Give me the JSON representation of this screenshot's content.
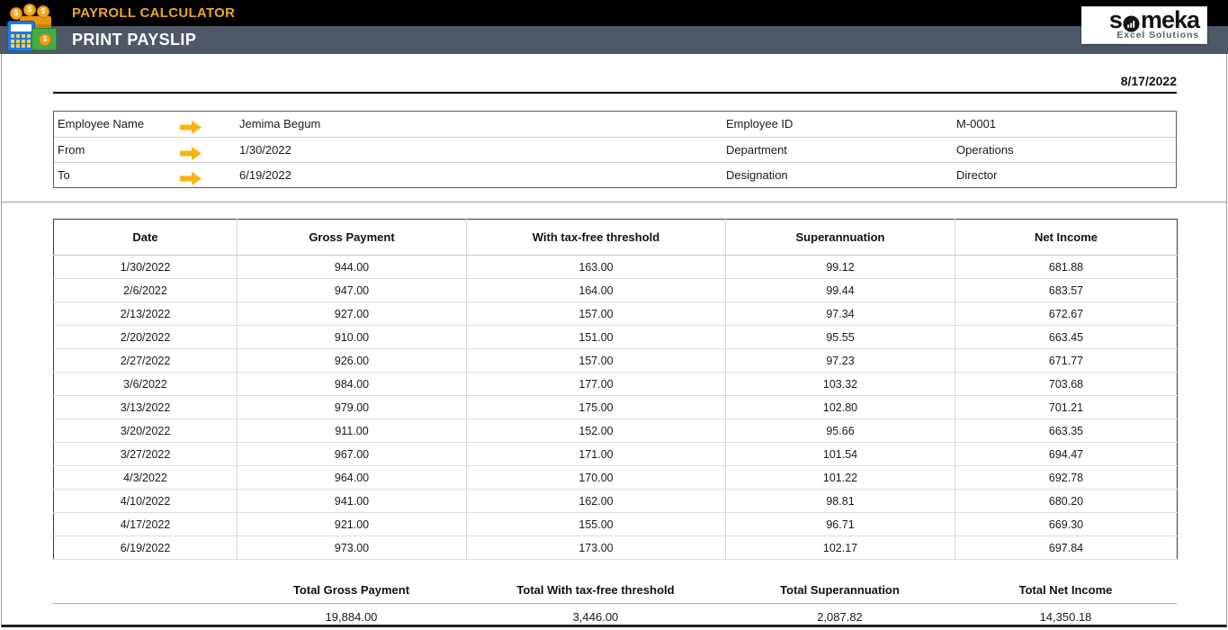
{
  "header": {
    "app_title": "PAYROLL CALCULATOR",
    "page_title": "PRINT PAYSLIP",
    "app_icon": "payroll-calculator-icon",
    "logo": {
      "brand": "someka",
      "text_before_icon": "s",
      "text_after_icon": "meka",
      "tagline": "Excel Solutions",
      "chart_icon": "circle-bar-chart-icon"
    }
  },
  "document": {
    "date": "8/17/2022",
    "employee": {
      "left": [
        {
          "label": "Employee Name",
          "value": "Jemima Begum"
        },
        {
          "label": "From",
          "value": "1/30/2022"
        },
        {
          "label": "To",
          "value": "6/19/2022"
        }
      ],
      "right": [
        {
          "label": "Employee ID",
          "value": "M-0001"
        },
        {
          "label": "Department",
          "value": "Operations"
        },
        {
          "label": "Designation",
          "value": "Director"
        }
      ],
      "row_arrow_icon": "right-arrow-icon"
    }
  },
  "payslip_table": {
    "columns": [
      "Date",
      "Gross Payment",
      "With tax-free threshold",
      "Superannuation",
      "Net Income"
    ],
    "rows": [
      [
        "1/30/2022",
        "944.00",
        "163.00",
        "99.12",
        "681.88"
      ],
      [
        "2/6/2022",
        "947.00",
        "164.00",
        "99.44",
        "683.57"
      ],
      [
        "2/13/2022",
        "927.00",
        "157.00",
        "97.34",
        "672.67"
      ],
      [
        "2/20/2022",
        "910.00",
        "151.00",
        "95.55",
        "663.45"
      ],
      [
        "2/27/2022",
        "926.00",
        "157.00",
        "97.23",
        "671.77"
      ],
      [
        "3/6/2022",
        "984.00",
        "177.00",
        "103.32",
        "703.68"
      ],
      [
        "3/13/2022",
        "979.00",
        "175.00",
        "102.80",
        "701.21"
      ],
      [
        "3/20/2022",
        "911.00",
        "152.00",
        "95.66",
        "663.35"
      ],
      [
        "3/27/2022",
        "967.00",
        "171.00",
        "101.54",
        "694.47"
      ],
      [
        "4/3/2022",
        "964.00",
        "170.00",
        "101.22",
        "692.78"
      ],
      [
        "4/10/2022",
        "941.00",
        "162.00",
        "98.81",
        "680.20"
      ],
      [
        "4/17/2022",
        "921.00",
        "155.00",
        "96.71",
        "669.30"
      ],
      [
        "6/19/2022",
        "973.00",
        "173.00",
        "102.17",
        "697.84"
      ]
    ],
    "totals": {
      "labels": [
        "Total Gross Payment",
        "Total With tax-free threshold",
        "Total Superannuation",
        "Total Net Income"
      ],
      "values": [
        "19,884.00",
        "3,446.00",
        "2,087.82",
        "14,350.18"
      ]
    }
  },
  "colors": {
    "top_bar": "#000000",
    "title_orange": "#E9A62E",
    "band_slate": "#4E5866",
    "arrow_yellow": "#F8B410",
    "row_separator": "#C8CEDA",
    "table_border": "#3A3A3A"
  }
}
